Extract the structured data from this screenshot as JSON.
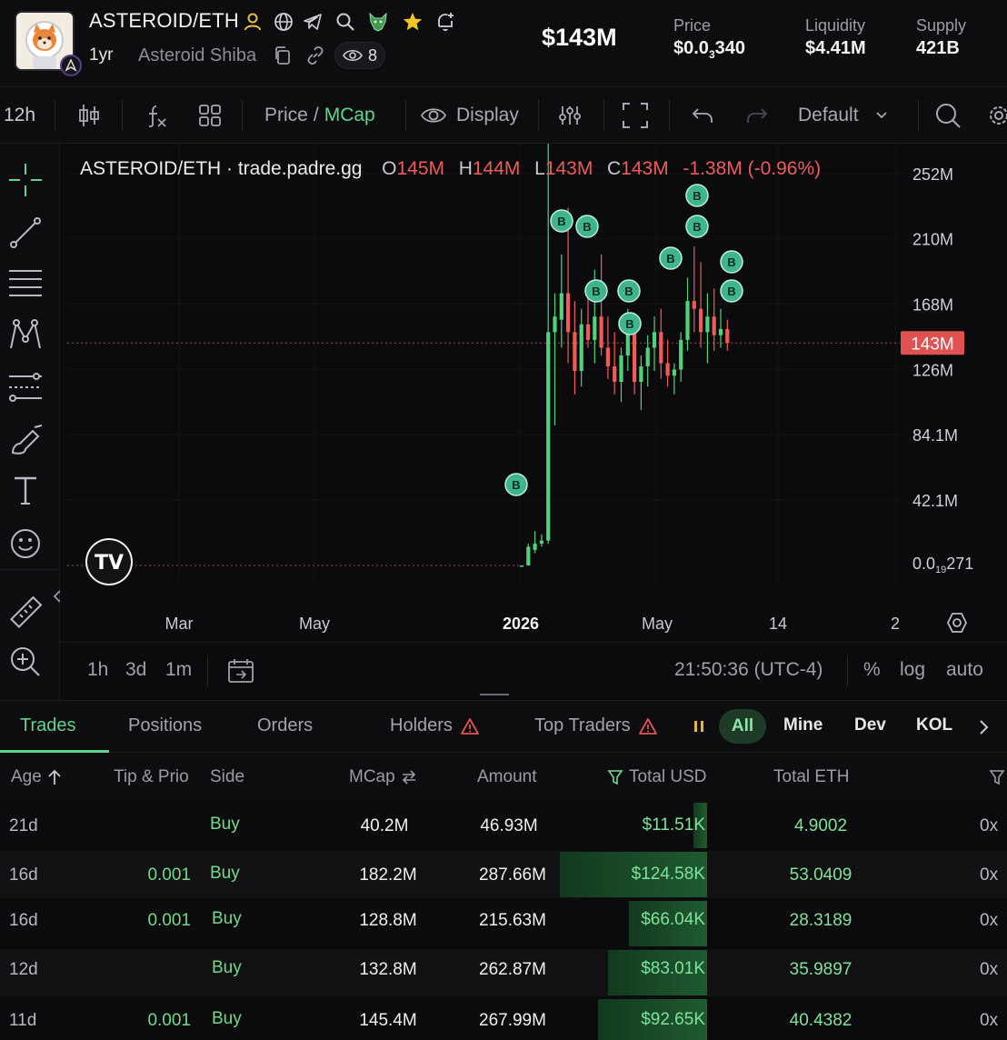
{
  "header": {
    "pair": "ASTEROID/ETH",
    "age": "1yr",
    "name": "Asteroid Shiba",
    "watchers": "8",
    "market_cap": "$143M",
    "stats": [
      {
        "label": "Price",
        "value_prefix": "$0.0",
        "value_sub": "3",
        "value_suffix": "340"
      },
      {
        "label": "Liquidity",
        "value": "$4.41M"
      },
      {
        "label": "Supply",
        "value": "421B"
      }
    ],
    "icons": [
      "person-icon",
      "globe-icon",
      "telegram-icon",
      "search-icon",
      "wolf-icon",
      "star-icon",
      "bell-plus-icon"
    ]
  },
  "toolbar": {
    "interval": "12h",
    "price_label": "Price",
    "slash": "/",
    "mcap_label": "MCap",
    "display_label": "Display",
    "layout_label": "Default"
  },
  "chart": {
    "legend_title": "ASTEROID/ETH · trade.padre.gg",
    "o_label": "O",
    "o_value": "145M",
    "h_label": "H",
    "h_value": "144M",
    "l_label": "L",
    "l_value": "143M",
    "c_label": "C",
    "c_value": "143M",
    "change": "-1.38M (-0.96%)",
    "last_price_tag": "143M",
    "bottom_left_value_prefix": "0.0",
    "bottom_left_value_sub": "19",
    "bottom_left_value_suffix": "271",
    "buy_marker": "B",
    "logo_text": "TV"
  },
  "chart_data": {
    "type": "candlestick",
    "title": "ASTEROID/ETH · trade.padre.gg",
    "y_ticks": [
      "252M",
      "210M",
      "168M",
      "126M",
      "84.1M",
      "42.1M"
    ],
    "x_ticks": [
      "Mar",
      "May",
      "2026",
      "May",
      "14",
      "2"
    ],
    "ylim": [
      0,
      270
    ],
    "y_unit": "M",
    "last_value": 143,
    "ohlc": [
      [
        0,
        0,
        0,
        0
      ],
      [
        0,
        14,
        0,
        12
      ],
      [
        10,
        22,
        8,
        14
      ],
      [
        14,
        20,
        12,
        16
      ],
      [
        16,
        275,
        14,
        150
      ],
      [
        150,
        175,
        90,
        160
      ],
      [
        158,
        200,
        140,
        175
      ],
      [
        175,
        230,
        130,
        150
      ],
      [
        150,
        170,
        110,
        125
      ],
      [
        125,
        165,
        115,
        155
      ],
      [
        155,
        180,
        140,
        145
      ],
      [
        145,
        190,
        130,
        160
      ],
      [
        160,
        200,
        135,
        140
      ],
      [
        140,
        160,
        120,
        128
      ],
      [
        128,
        150,
        110,
        118
      ],
      [
        118,
        140,
        105,
        135
      ],
      [
        135,
        165,
        125,
        150
      ],
      [
        150,
        155,
        110,
        118
      ],
      [
        118,
        135,
        100,
        128
      ],
      [
        128,
        148,
        115,
        140
      ],
      [
        140,
        160,
        125,
        150
      ],
      [
        150,
        165,
        120,
        130
      ],
      [
        130,
        145,
        115,
        122
      ],
      [
        122,
        130,
        110,
        126
      ],
      [
        126,
        150,
        118,
        145
      ],
      [
        145,
        185,
        138,
        170
      ],
      [
        170,
        205,
        150,
        165
      ],
      [
        165,
        195,
        140,
        150
      ],
      [
        150,
        175,
        130,
        160
      ],
      [
        160,
        178,
        138,
        148
      ],
      [
        148,
        165,
        140,
        152
      ],
      [
        152,
        158,
        138,
        143
      ]
    ]
  },
  "chart_bottom": {
    "intervals": [
      "1h",
      "3d",
      "1m"
    ],
    "time": "21:50:36 (UTC-4)",
    "percent": "%",
    "log": "log",
    "auto": "auto"
  },
  "tabs": {
    "items": [
      "Trades",
      "Positions",
      "Orders",
      "Holders",
      "Top Traders"
    ],
    "filters": [
      "All",
      "Mine",
      "Dev",
      "KOL"
    ]
  },
  "table": {
    "columns": [
      "Age",
      "Tip & Prio",
      "Side",
      "MCap",
      "Amount",
      "Total USD",
      "Total ETH"
    ],
    "rows": [
      {
        "age": "21d",
        "tip": "",
        "side": "Buy",
        "mcap": "40.2M",
        "amount": "46.93M",
        "usd": "$11.51K",
        "eth": "4.9002",
        "maker": "0x",
        "usd_fill": 0.09
      },
      {
        "age": "16d",
        "tip": "0.001",
        "side": "Buy",
        "mcap": "182.2M",
        "amount": "287.66M",
        "usd": "$124.58K",
        "eth": "53.0409",
        "maker": "0x",
        "usd_fill": 1.0
      },
      {
        "age": "16d",
        "tip": "0.001",
        "side": "Buy",
        "mcap": "128.8M",
        "amount": "215.63M",
        "usd": "$66.04K",
        "eth": "28.3189",
        "maker": "0x",
        "usd_fill": 0.53
      },
      {
        "age": "12d",
        "tip": "",
        "side": "Buy",
        "mcap": "132.8M",
        "amount": "262.87M",
        "usd": "$83.01K",
        "eth": "35.9897",
        "maker": "0x",
        "usd_fill": 0.67
      },
      {
        "age": "11d",
        "tip": "0.001",
        "side": "Buy",
        "mcap": "145.4M",
        "amount": "267.99M",
        "usd": "$92.65K",
        "eth": "40.4382",
        "maker": "0x",
        "usd_fill": 0.74
      }
    ]
  },
  "colors": {
    "up": "#4fd27a",
    "down": "#ef5b5b",
    "accent": "#5fd48e",
    "marker": "#3fb58f"
  }
}
